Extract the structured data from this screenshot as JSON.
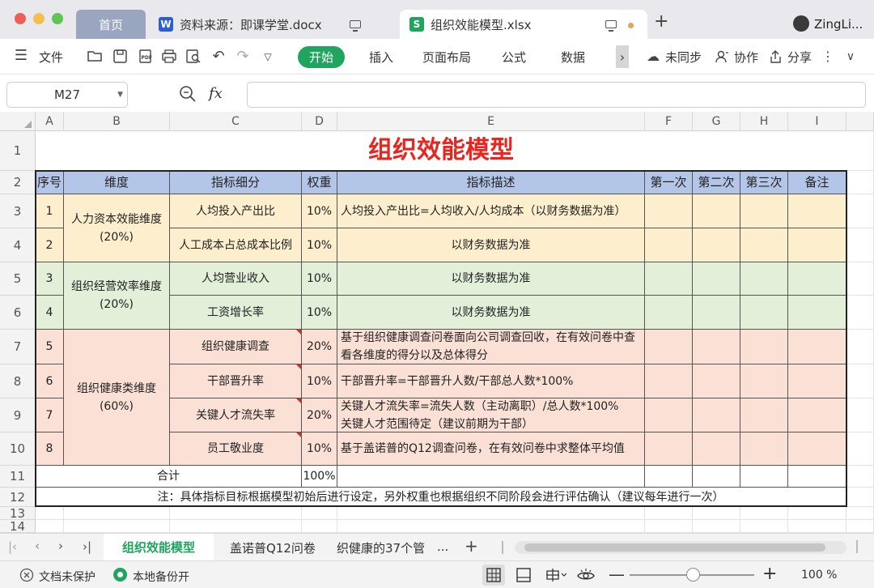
{
  "window": {
    "tabs": [
      {
        "label": "首页"
      },
      {
        "label": "资料来源：即课学堂.docx",
        "icon": "W",
        "icon_color": "#2b5fd0"
      },
      {
        "label": "组织效能模型.xlsx",
        "icon": "S",
        "icon_color": "#1fa55d"
      }
    ],
    "new_tab": "+",
    "user": "ZingLi..."
  },
  "menu": {
    "file": "文件",
    "tabs": [
      "开始",
      "插入",
      "页面布局",
      "公式",
      "数据"
    ],
    "more": "›",
    "sync": "未同步",
    "collab": "协作",
    "share": "分享"
  },
  "formula": {
    "cell_ref": "M27",
    "fx": "fx",
    "value": ""
  },
  "sheet": {
    "columns": [
      "A",
      "B",
      "C",
      "D",
      "E",
      "F",
      "G",
      "H",
      "I"
    ],
    "rows": [
      "1",
      "2",
      "3",
      "4",
      "5",
      "6",
      "7",
      "8",
      "9",
      "10",
      "11",
      "12",
      "13",
      "14"
    ],
    "title": "组织效能模型",
    "header": [
      "序号",
      "维度",
      "指标细分",
      "权重",
      "指标描述",
      "第一次",
      "第二次",
      "第三次",
      "备注"
    ],
    "dims": [
      {
        "label": "人力资本效能维度\n(20%)"
      },
      {
        "label": "组织经营效率维度\n(20%)"
      },
      {
        "label": "组织健康类维度\n(60%)"
      }
    ],
    "data": [
      {
        "no": "1",
        "metric": "人均投入产出比",
        "weight": "10%",
        "desc": "人均投入产出比=人均收入/人均成本（以财务数据为准）"
      },
      {
        "no": "2",
        "metric": "人工成本占总成本比例",
        "weight": "10%",
        "desc": "以财务数据为准"
      },
      {
        "no": "3",
        "metric": "人均营业收入",
        "weight": "10%",
        "desc": "以财务数据为准"
      },
      {
        "no": "4",
        "metric": "工资增长率",
        "weight": "10%",
        "desc": "以财务数据为准"
      },
      {
        "no": "5",
        "metric": "组织健康调查",
        "weight": "20%",
        "desc": "基于组织健康调查问卷面向公司调查回收，在有效问卷中查看各维度的得分以及总体得分"
      },
      {
        "no": "6",
        "metric": "干部晋升率",
        "weight": "10%",
        "desc": "干部晋升率=干部晋升人数/干部总人数*100%"
      },
      {
        "no": "7",
        "metric": "关键人才流失率",
        "weight": "20%",
        "desc": "关键人才流失率=流失人数（主动离职）/总人数*100%\n关键人才范围待定（建议前期为干部）"
      },
      {
        "no": "8",
        "metric": "员工敬业度",
        "weight": "10%",
        "desc": "基于盖诺普的Q12调查问卷，在有效问卷中求整体平均值"
      }
    ],
    "total_label": "合计",
    "total_value": "100%",
    "note": "注：具体指标目标根据模型初始后进行设定，另外权重也根据组织不同阶段会进行评估确认（建议每年进行一次）"
  },
  "sheet_tabs": {
    "active": "组织效能模型",
    "others": [
      "盖诺普Q12问卷",
      "织健康的37个管"
    ],
    "more": "...",
    "add": "+"
  },
  "status": {
    "protect": "文档未保护",
    "backup": "本地备份开",
    "zoom": "100 %"
  }
}
